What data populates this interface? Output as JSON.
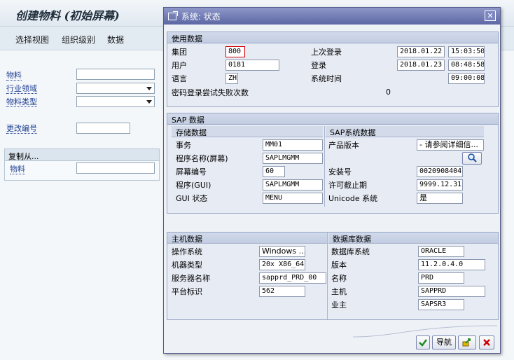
{
  "background": {
    "title": "创建物料 (初始屏幕)",
    "menu": [
      "选择视图",
      "组织级别",
      "数据"
    ],
    "fields": {
      "material": "物料",
      "industry": "行业领域",
      "material_type": "物料类型",
      "change_number": "更改编号"
    },
    "copy_from": {
      "title": "复制从...",
      "material": "物料"
    }
  },
  "dialog": {
    "title": "系统: 状态",
    "close": "✕",
    "usage": {
      "title": "使用数据",
      "client_label": "集团",
      "client": "800",
      "user_label": "用户",
      "user": "0181",
      "language_label": "语言",
      "language": "ZH",
      "prev_logon_label": "上次登录",
      "prev_logon_date": "2018.01.22",
      "prev_logon_time": "15:03:50",
      "logon_label": "登录",
      "logon_date": "2018.01.23",
      "logon_time": "08:48:58",
      "system_time_label": "系统时间",
      "system_time": "09:00:08",
      "failed_label": "密码登录尝试失败次数",
      "failed": "0"
    },
    "sap": {
      "title": "SAP 数据",
      "repo": {
        "title": "存储数据",
        "transaction_label": "事务",
        "transaction": "MM01",
        "program_screen_label": "程序名称(屏幕)",
        "program_screen": "SAPLMGMM",
        "screen_number_label": "屏幕编号",
        "screen_number": "60",
        "program_gui_label": "程序(GUI)",
        "program_gui": "SAPLMGMM",
        "gui_status_label": "GUI 状态",
        "gui_status": "MENU"
      },
      "system": {
        "title": "SAP系统数据",
        "product_version_label": "产品版本",
        "product_version": "- 请参阅详细信...",
        "install_no_label": "安装号",
        "install_no": "0020908404",
        "license_exp_label": "许可截止期",
        "license_exp": "9999.12.31",
        "unicode_label": "Unicode 系统",
        "unicode": "是"
      }
    },
    "host": {
      "title": "主机数据",
      "os_label": "操作系统",
      "os": "Windows ...",
      "machine_label": "机器类型",
      "machine": "20x X86_64",
      "server_label": "服务器名称",
      "server": "sapprd_PRD_00",
      "platform_label": "平台标识",
      "platform": "562"
    },
    "db": {
      "title": "数据库数据",
      "system_label": "数据库系统",
      "system": "ORACLE",
      "release_label": "版本",
      "release": "11.2.0.4.0",
      "name_label": "名称",
      "name": "PRD",
      "host_label": "主机",
      "host": "SAPPRD",
      "owner_label": "业主",
      "owner": "SAPSR3"
    },
    "buttons": {
      "navigate": "导航"
    }
  },
  "colors": {
    "title_bar": "#5c67a4",
    "label_link": "#1d3d91",
    "focus_border": "#d30000",
    "ok_green": "#1a8a1a",
    "cancel_red": "#cc0000"
  },
  "icons": [
    "window-icon",
    "close-icon",
    "magnifier-icon",
    "check-icon",
    "navigate-icon",
    "cancel-icon"
  ]
}
